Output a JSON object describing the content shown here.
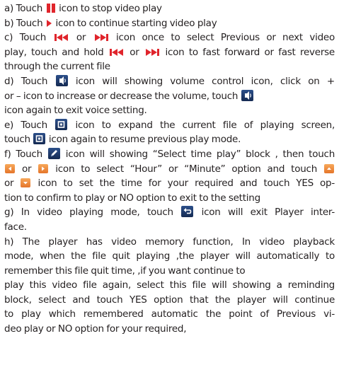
{
  "icons": {
    "pause": "pause-icon",
    "play": "play-icon",
    "previous": "previous-track-icon",
    "next": "next-track-icon",
    "volume": "volume-icon",
    "fullscreen": "fullscreen-icon",
    "edit": "pencil-icon",
    "left_arrow": "left-arrow-icon",
    "right_arrow": "right-arrow-icon",
    "up_arrow": "up-arrow-icon",
    "down_arrow": "down-arrow-icon",
    "back": "return-icon"
  },
  "colors": {
    "text": "#231f20",
    "red_icon": "#e0252c",
    "dark_icon": "#1f3a6b",
    "orange_icon": "#ef8c3c"
  },
  "lines": [
    [
      "a) Touch ",
      " icon to stop video play"
    ],
    [
      "b) Touch ",
      " icon to continue starting video play"
    ],
    [
      "c) Touch ",
      " or ",
      " icon once to select Previous or next video"
    ],
    [
      "play, touch and hold ",
      " or ",
      " icon to fast forward or fast reverse"
    ],
    [
      "through the current file"
    ],
    [
      "d) Touch ",
      " icon will showing volume control icon, click on +"
    ],
    [
      "or – icon to increase or decrease the volume, touch ",
      ""
    ],
    [
      "icon again to exit voice setting."
    ],
    [
      "e) Touch ",
      " icon to expand the current file of playing screen,"
    ],
    [
      "touch ",
      " icon again to resume previous play mode."
    ],
    [
      "f) Touch ",
      " icon will showing “Select time play” block , then touch"
    ],
    [
      "",
      " or ",
      " icon to select “Hour” or “Minute” option and touch ",
      ""
    ],
    [
      "or ",
      " icon to set the time for your required and touch YES op-"
    ],
    [
      "tion to confirm to play or NO option to exit to the setting"
    ],
    [
      "g) In video playing mode, touch ",
      " icon will exit Player inter-"
    ],
    [
      "face."
    ],
    [
      "h) The player has video memory function, In video playback"
    ],
    [
      "mode, when the file quit playing ,the player will automatically to"
    ],
    [
      "remember this file quit time, ,if you want continue to"
    ],
    [
      "play this video file again, select this file will showing a reminding"
    ],
    [
      "block, select and touch YES option that the player will continue"
    ],
    [
      "to play which remembered automatic the point of Previous vi-"
    ],
    [
      "deo play or NO option for your required,"
    ]
  ]
}
